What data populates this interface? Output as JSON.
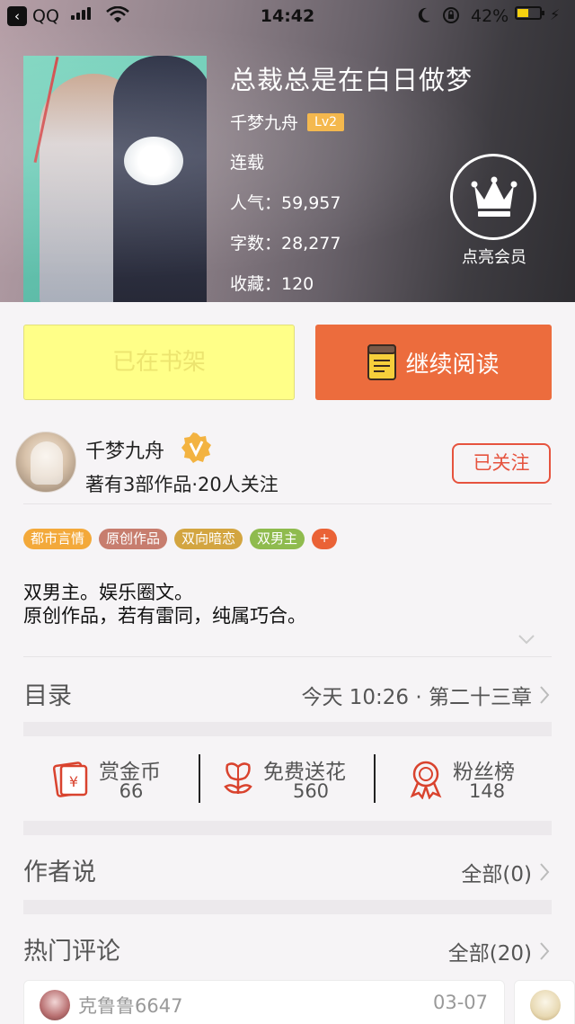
{
  "status_bar": {
    "back_app": "QQ",
    "time": "14:42",
    "battery_pct": "42%"
  },
  "book": {
    "title": "总裁总是在白日做梦",
    "author": "千梦九舟",
    "author_level": "Lv2",
    "status": "连载",
    "popularity": "人气：59,957",
    "word_count": "字数：28,277",
    "favorites": "收藏：120"
  },
  "member": {
    "label": "点亮会员"
  },
  "actions": {
    "shelf_label": "已在书架",
    "read_label": "继续阅读"
  },
  "author_card": {
    "name": "千梦九舟",
    "meta": "著有3部作品·20人关注",
    "follow_label": "已关注"
  },
  "tags": [
    {
      "label": "都市言情",
      "color": "#f3a93a"
    },
    {
      "label": "原创作品",
      "color": "#c77d6e"
    },
    {
      "label": "双向暗恋",
      "color": "#d3a540"
    },
    {
      "label": "双男主",
      "color": "#8fbb4e"
    }
  ],
  "tag_add_label": "+",
  "description": {
    "line1": "双男主。娱乐圈文。",
    "line2": "原创作品，若有雷同，纯属巧合。"
  },
  "toc": {
    "title": "目录",
    "latest": "今天 10:26 · 第二十三章"
  },
  "rewards": [
    {
      "label": "赏金币",
      "value": "66",
      "icon": "red-envelope-icon"
    },
    {
      "label": "免费送花",
      "value": "560",
      "icon": "flower-icon"
    },
    {
      "label": "粉丝榜",
      "value": "148",
      "icon": "medal-icon"
    }
  ],
  "author_say": {
    "title": "作者说",
    "count": "全部(0)"
  },
  "hot_comments": {
    "title": "热门评论",
    "count": "全部(20)",
    "items": [
      {
        "user": "克鲁鲁6647",
        "date": "03-07"
      }
    ]
  },
  "colors": {
    "accent_orange": "#ec6c3d",
    "shelf_yellow": "#ffff88",
    "follow_red": "#e6533e",
    "level_badge": "#f3b341"
  }
}
